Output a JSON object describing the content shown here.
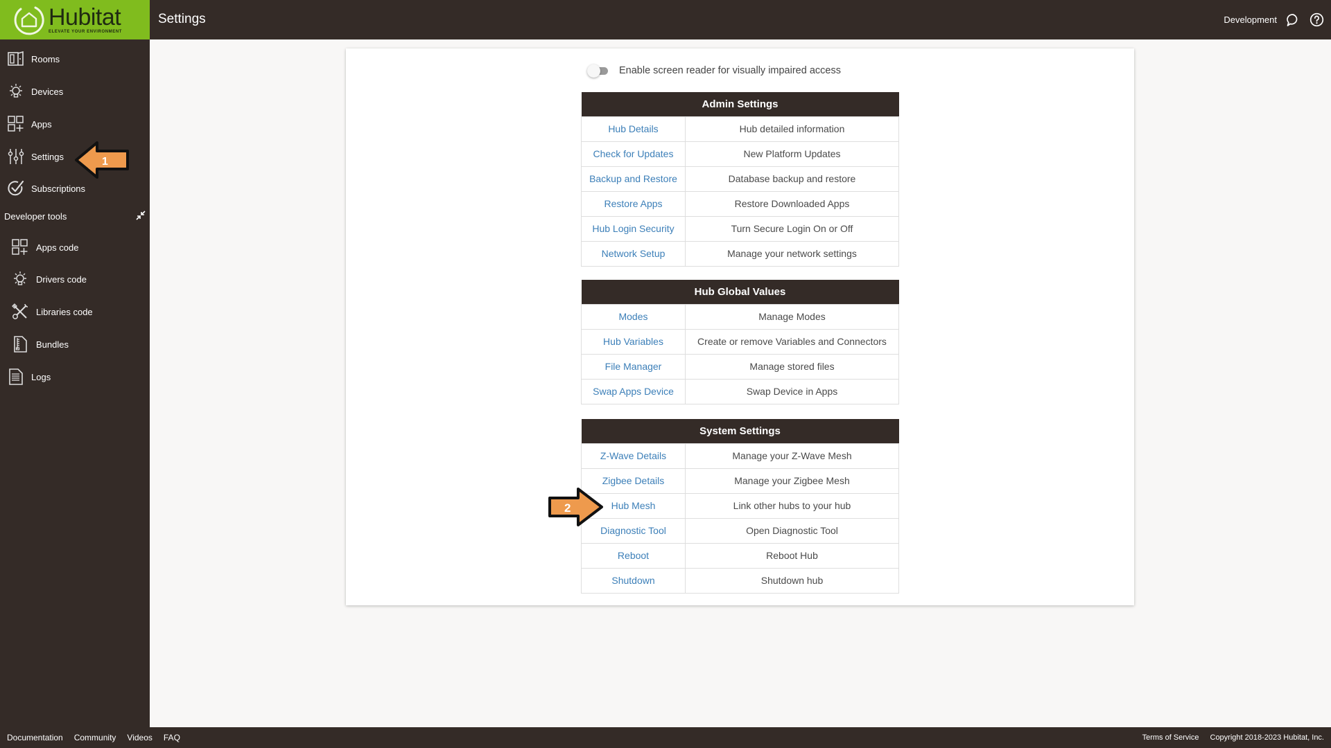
{
  "header": {
    "logo_word": "Hubitat",
    "logo_tagline": "ELEVATE YOUR ENVIRONMENT",
    "title": "Settings",
    "environment": "Development",
    "icons": [
      "chat-bubble-icon",
      "help-icon"
    ]
  },
  "sidebar": {
    "items": [
      {
        "label": "Rooms",
        "icon": "rooms-icon"
      },
      {
        "label": "Devices",
        "icon": "lightbulb-icon"
      },
      {
        "label": "Apps",
        "icon": "apps-grid-icon"
      },
      {
        "label": "Settings",
        "icon": "sliders-icon"
      },
      {
        "label": "Subscriptions",
        "icon": "check-circle-icon"
      }
    ],
    "developer_tools": {
      "label": "Developer tools",
      "items": [
        {
          "label": "Apps code",
          "icon": "apps-grid-icon"
        },
        {
          "label": "Drivers code",
          "icon": "lightbulb-icon"
        },
        {
          "label": "Libraries code",
          "icon": "tools-icon"
        },
        {
          "label": "Bundles",
          "icon": "bundle-icon"
        },
        {
          "label": "Logs",
          "icon": "document-icon"
        }
      ]
    }
  },
  "main": {
    "screen_reader_toggle": {
      "label": "Enable screen reader for visually impaired access",
      "enabled": false
    },
    "sections": [
      {
        "title": "Admin Settings",
        "rows": [
          {
            "link": "Hub Details",
            "desc": "Hub detailed information"
          },
          {
            "link": "Check for Updates",
            "desc": "New Platform Updates"
          },
          {
            "link": "Backup and Restore",
            "desc": "Database backup and restore"
          },
          {
            "link": "Restore Apps",
            "desc": "Restore Downloaded Apps"
          },
          {
            "link": "Hub Login Security",
            "desc": "Turn Secure Login On or Off"
          },
          {
            "link": "Network Setup",
            "desc": "Manage your network settings"
          }
        ]
      },
      {
        "title": "Hub Global Values",
        "rows": [
          {
            "link": "Modes",
            "desc": "Manage Modes"
          },
          {
            "link": "Hub Variables",
            "desc": "Create or remove Variables and Connectors"
          },
          {
            "link": "File Manager",
            "desc": "Manage stored files"
          },
          {
            "link": "Swap Apps Device",
            "desc": "Swap Device in Apps"
          }
        ]
      },
      {
        "title": "System Settings",
        "rows": [
          {
            "link": "Z-Wave Details",
            "desc": "Manage your Z-Wave Mesh"
          },
          {
            "link": "Zigbee Details",
            "desc": "Manage your Zigbee Mesh"
          },
          {
            "link": "Hub Mesh",
            "desc": "Link other hubs to your hub"
          },
          {
            "link": "Diagnostic Tool",
            "desc": "Open Diagnostic Tool"
          },
          {
            "link": "Reboot",
            "desc": "Reboot Hub"
          },
          {
            "link": "Shutdown",
            "desc": "Shutdown hub"
          }
        ]
      }
    ]
  },
  "annotations": [
    {
      "label": "1",
      "target": "Settings"
    },
    {
      "label": "2",
      "target": "Hub Mesh"
    }
  ],
  "footer": {
    "links": [
      "Documentation",
      "Community",
      "Videos",
      "FAQ"
    ],
    "terms": "Terms of Service",
    "copyright": "Copyright 2018-2023 Hubitat, Inc."
  },
  "colors": {
    "brand_green": "#80bc1e",
    "dark_brown": "#342b27",
    "link_blue": "#3c7fb8",
    "annotation_orange": "#ee9a4d"
  }
}
